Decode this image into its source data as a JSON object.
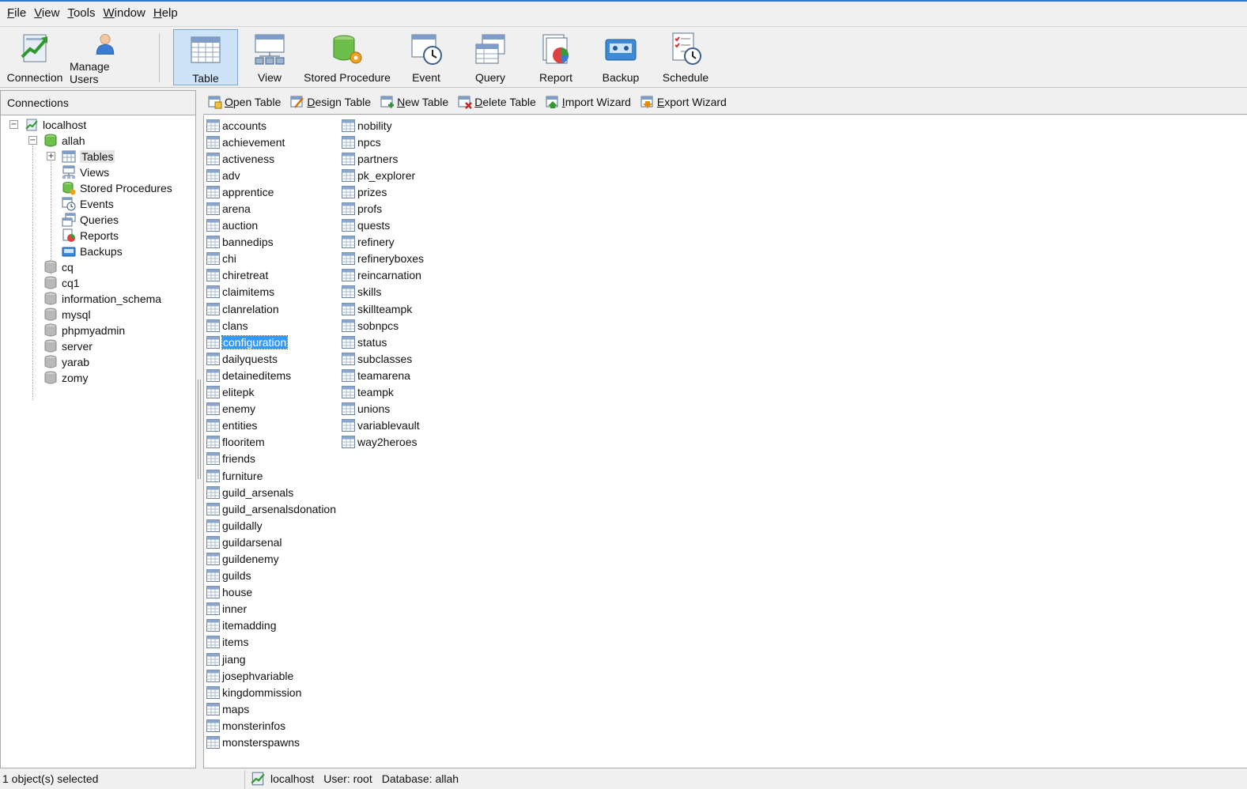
{
  "menu": [
    {
      "mnemonic": "F",
      "rest": "ile"
    },
    {
      "mnemonic": "V",
      "rest": "iew"
    },
    {
      "mnemonic": "T",
      "rest": "ools"
    },
    {
      "mnemonic": "W",
      "rest": "indow"
    },
    {
      "mnemonic": "H",
      "rest": "elp"
    }
  ],
  "toolbar": {
    "connection": "Connection",
    "manage_users": "Manage Users",
    "table": "Table",
    "view": "View",
    "stored_procedure": "Stored Procedure",
    "event": "Event",
    "query": "Query",
    "report": "Report",
    "backup": "Backup",
    "schedule": "Schedule"
  },
  "connections_panel": {
    "header": "Connections",
    "tree": {
      "localhost": "localhost",
      "allah": "allah",
      "tables": "Tables",
      "views": "Views",
      "stored_procedures": "Stored Procedures",
      "events": "Events",
      "queries": "Queries",
      "reports": "Reports",
      "backups": "Backups",
      "databases": [
        "cq",
        "cq1",
        "information_schema",
        "mysql",
        "phpmyadmin",
        "server",
        "yarab",
        "zomy"
      ]
    }
  },
  "object_toolbar": {
    "open_table": {
      "mnemonic": "O",
      "rest": "pen Table"
    },
    "design_table": {
      "mnemonic": "D",
      "rest": "esign Table"
    },
    "new_table": {
      "mnemonic": "N",
      "rest": "ew Table"
    },
    "delete_table": {
      "mnemonic": "D",
      "rest": "elete Table"
    },
    "import_wizard": {
      "mnemonic": "I",
      "rest": "mport Wizard"
    },
    "export_wizard": {
      "mnemonic": "E",
      "rest": "xport Wizard"
    }
  },
  "tables": {
    "selected": "configuration",
    "column1": [
      "accounts",
      "achievement",
      "activeness",
      "adv",
      "apprentice",
      "arena",
      "auction",
      "bannedips",
      "chi",
      "chiretreat",
      "claimitems",
      "clanrelation",
      "clans",
      "configuration",
      "dailyquests",
      "detaineditems",
      "elitepk",
      "enemy",
      "entities",
      "flooritem",
      "friends",
      "furniture",
      "guild_arsenals",
      "guild_arsenalsdonation",
      "guildally",
      "guildarsenal",
      "guildenemy",
      "guilds",
      "house",
      "inner",
      "itemadding",
      "items",
      "jiang",
      "josephvariable",
      "kingdommission",
      "maps",
      "monsterinfos",
      "monsterspawns"
    ],
    "column2": [
      "nobility",
      "npcs",
      "partners",
      "pk_explorer",
      "prizes",
      "profs",
      "quests",
      "refinery",
      "refineryboxes",
      "reincarnation",
      "skills",
      "skillteampk",
      "sobnpcs",
      "status",
      "subclasses",
      "teamarena",
      "teampk",
      "unions",
      "variablevault",
      "way2heroes"
    ]
  },
  "status": {
    "selection": "1 object(s) selected",
    "host": "localhost",
    "user": "User: root",
    "database": "Database: allah"
  }
}
